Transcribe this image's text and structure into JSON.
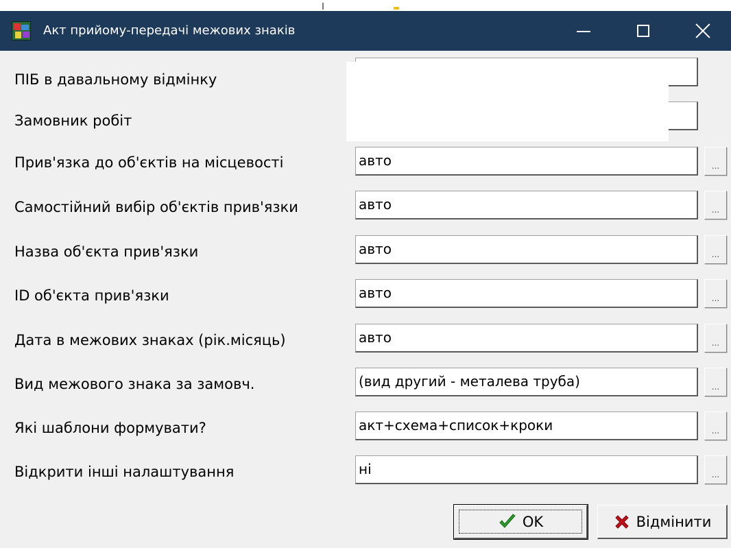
{
  "window": {
    "title": "Акт прийому-передачі межових знаків",
    "icon": "app-icon",
    "controls": [
      "minimize-icon",
      "maximize-icon",
      "close-icon"
    ]
  },
  "form": {
    "rows": [
      {
        "label": "ПІБ в давальному відмінку",
        "value": ""
      },
      {
        "label": "Замовник робіт",
        "value": ""
      },
      {
        "label": "Прив'язка до об'єктів на місцевості",
        "value": "авто"
      },
      {
        "label": "Самостійний вибір об'єктів прив'язки",
        "value": "авто"
      },
      {
        "label": "Назва об'єкта прив'язки",
        "value": "авто"
      },
      {
        "label": "ID об'єкта прив'язки",
        "value": "авто"
      },
      {
        "label": "Дата в межових знаках (рік.місяць)",
        "value": "авто"
      },
      {
        "label": "Вид межового знака за замовч.",
        "value": "(вид другий - металева труба)"
      },
      {
        "label": "Які шаблони формувати?",
        "value": "акт+схема+список+кроки"
      },
      {
        "label": "Відкрити інші налаштування",
        "value": "ні"
      }
    ],
    "ellipsis_label": "..."
  },
  "buttons": {
    "ok": {
      "label": "OK",
      "icon": "checkmark-icon",
      "icon_color": "#2a9a2a"
    },
    "cancel": {
      "label": "Відмінити",
      "icon": "cross-icon",
      "icon_color": "#c0101a"
    }
  },
  "colors": {
    "titlebar": "#1e3a5a",
    "window_bg": "#f0f0f0"
  }
}
